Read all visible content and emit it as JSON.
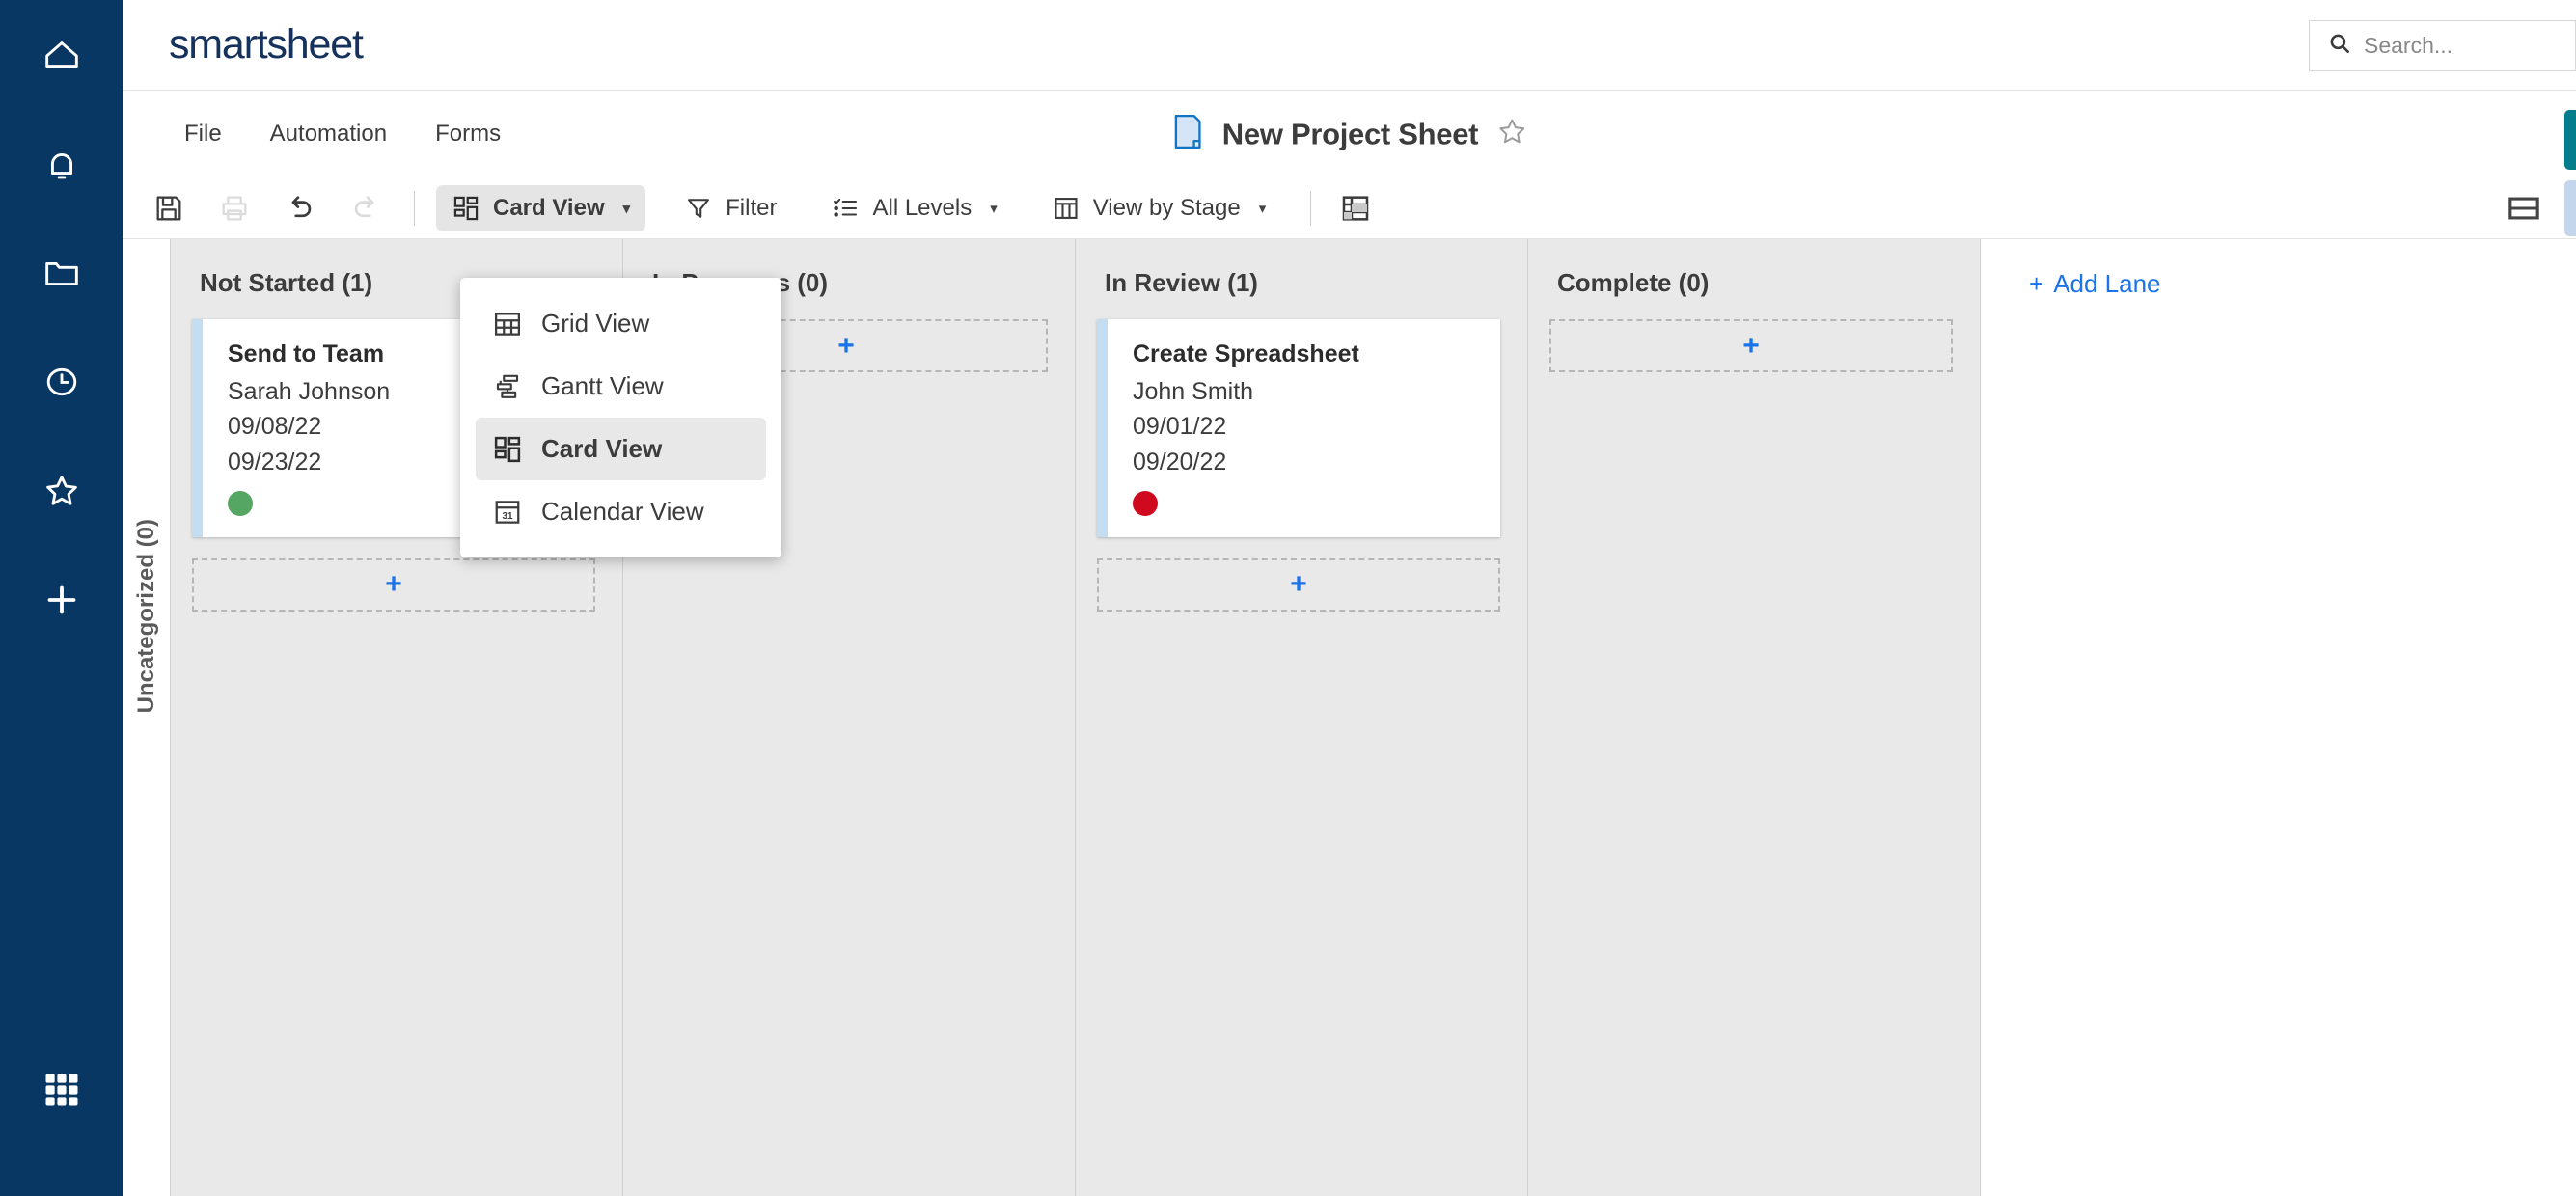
{
  "app": {
    "logo": "smartsheet",
    "brand_color": "#16325c",
    "rail_color": "#073762",
    "accent_blue": "#1a73e8"
  },
  "rail": {
    "items": [
      {
        "name": "home-icon",
        "label": "Home"
      },
      {
        "name": "bell-icon",
        "label": "Notifications"
      },
      {
        "name": "folder-icon",
        "label": "Browse"
      },
      {
        "name": "clock-icon",
        "label": "Recents"
      },
      {
        "name": "star-icon",
        "label": "Favorites"
      },
      {
        "name": "plus-icon",
        "label": "Create"
      }
    ],
    "apps_icon": "grid-apps-icon"
  },
  "search": {
    "placeholder": "Search...",
    "value": "",
    "icon": "search-icon"
  },
  "menu": {
    "items": [
      {
        "label": "File"
      },
      {
        "label": "Automation"
      },
      {
        "label": "Forms"
      }
    ]
  },
  "sheet": {
    "title": "New Project Sheet",
    "icon": "sheet-document-icon",
    "favorite_icon": "star-outline-icon",
    "favorited": false
  },
  "toolbar": {
    "save_icon": "save-disk-icon",
    "print_icon": "print-icon",
    "undo_icon": "undo-arrow-icon",
    "redo_icon": "redo-arrow-icon",
    "view_button": {
      "label": "Card View",
      "icon": "card-view-icon",
      "caret": "▾",
      "active": true
    },
    "filter_button": {
      "label": "Filter",
      "icon": "filter-funnel-icon"
    },
    "levels_button": {
      "label": "All Levels",
      "icon": "hierarchy-levels-icon",
      "caret": "▾"
    },
    "view_by_button": {
      "label": "View by Stage",
      "icon": "columns-icon",
      "caret": "▾"
    },
    "grid_settings_icon": "table-layout-icon",
    "right_panel_icon": "split-panel-icon"
  },
  "view_menu": {
    "open": true,
    "items": [
      {
        "label": "Grid View",
        "icon": "grid-view-icon",
        "selected": false
      },
      {
        "label": "Gantt View",
        "icon": "gantt-view-icon",
        "selected": false
      },
      {
        "label": "Card View",
        "icon": "card-view-icon",
        "selected": true
      },
      {
        "label": "Calendar View",
        "icon": "calendar-view-icon",
        "selected": false
      }
    ]
  },
  "board": {
    "swimlane_label": "Uncategorized (0)",
    "add_lane_label": "Add Lane",
    "add_card_symbol": "+",
    "lanes": [
      {
        "title": "Not Started (1)",
        "count": 1,
        "cards": [
          {
            "title": "Send to Team",
            "assignee": "Sarah Johnson",
            "start_date": "09/08/22",
            "end_date": "09/23/22",
            "status_color": "#55a563",
            "status_name": "green"
          }
        ]
      },
      {
        "title": "In Progress (0)",
        "count": 0,
        "cards": []
      },
      {
        "title": "In Review (1)",
        "count": 1,
        "cards": [
          {
            "title": "Create Spreadsheet",
            "assignee": "John Smith",
            "start_date": "09/01/22",
            "end_date": "09/20/22",
            "status_color": "#d00a1e",
            "status_name": "red"
          }
        ]
      },
      {
        "title": "Complete (0)",
        "count": 0,
        "cards": []
      }
    ]
  }
}
